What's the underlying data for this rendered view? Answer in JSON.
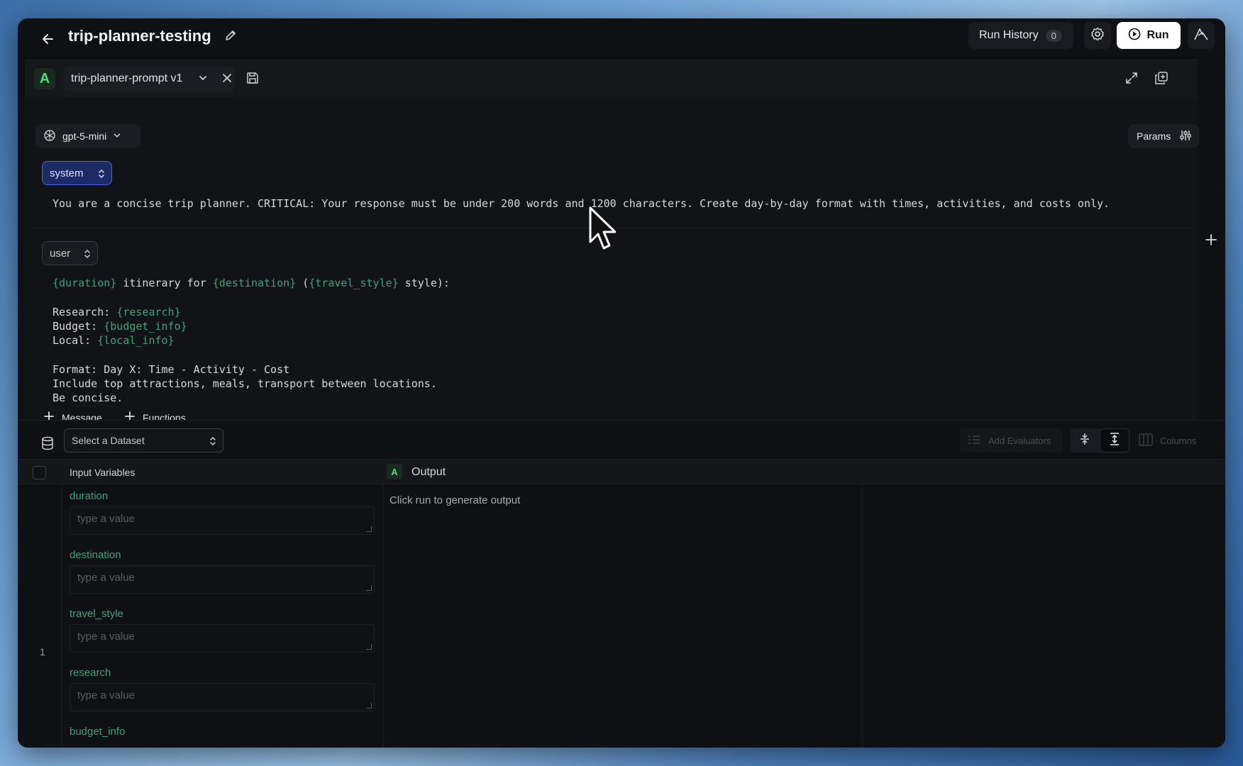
{
  "header": {
    "title": "trip-planner-testing",
    "run_history_label": "Run History",
    "run_history_count": "0",
    "run_label": "Run"
  },
  "prompt": {
    "avatar": "A",
    "name": "trip-planner-prompt v1",
    "model": "gpt-5-mini",
    "params_label": "Params"
  },
  "messages": {
    "system_role": "system",
    "system_text": "You are a concise trip planner. CRITICAL: Your response must be under 200 words and 1200 characters. Create day-by-day format with times, activities, and costs only.",
    "user_role": "user",
    "user_lines": [
      {
        "parts": [
          [
            "var",
            "{duration}"
          ],
          [
            "txt",
            " itinerary for "
          ],
          [
            "var",
            "{destination}"
          ],
          [
            "txt",
            " ("
          ],
          [
            "var",
            "{travel_style}"
          ],
          [
            "txt",
            " style):"
          ]
        ]
      },
      {
        "parts": []
      },
      {
        "parts": [
          [
            "txt",
            "Research: "
          ],
          [
            "var",
            "{research}"
          ]
        ]
      },
      {
        "parts": [
          [
            "txt",
            "Budget: "
          ],
          [
            "var",
            "{budget_info}"
          ]
        ]
      },
      {
        "parts": [
          [
            "txt",
            "Local: "
          ],
          [
            "var",
            "{local_info}"
          ]
        ]
      },
      {
        "parts": []
      },
      {
        "parts": [
          [
            "txt",
            "Format: Day X: Time - Activity - Cost"
          ]
        ]
      },
      {
        "parts": [
          [
            "txt",
            "Include top attractions, meals, transport between locations."
          ]
        ]
      },
      {
        "parts": [
          [
            "txt",
            "Be concise."
          ]
        ]
      }
    ],
    "add_message_label": "Message",
    "add_functions_label": "Functions"
  },
  "toolbar": {
    "dataset_placeholder": "Select a Dataset",
    "add_evaluators_label": "Add Evaluators",
    "columns_label": "Columns"
  },
  "table": {
    "input_header": "Input Variables",
    "output_avatar": "A",
    "output_header": "Output",
    "row_number": "1",
    "output_placeholder": "Click run to generate output",
    "input_placeholder": "type a value",
    "variables": [
      "duration",
      "destination",
      "travel_style",
      "research",
      "budget_info"
    ]
  },
  "colors": {
    "accent_green": "#3fa27a",
    "system_role_bg": "#1e2a66",
    "system_role_border": "#4f64e0"
  }
}
